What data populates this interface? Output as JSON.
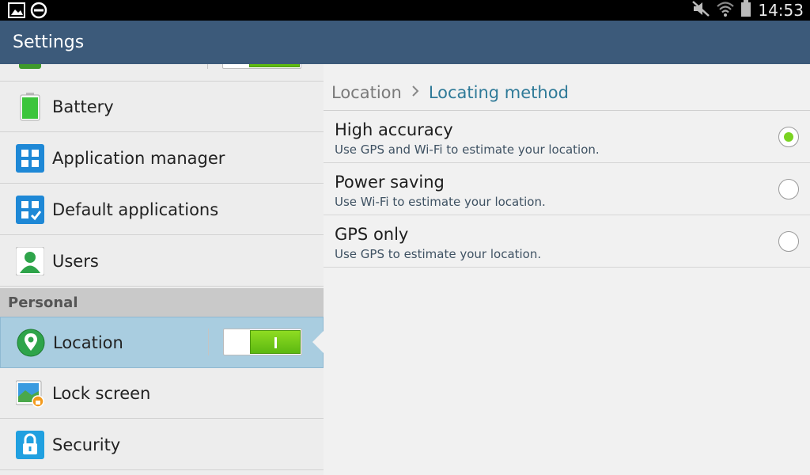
{
  "status_bar": {
    "time": "14:53",
    "left_icons": [
      "gallery-icon",
      "do-not-disturb-icon"
    ],
    "right_icons": [
      "mute-icon",
      "wifi-icon",
      "battery-icon"
    ]
  },
  "action_bar": {
    "title": "Settings"
  },
  "left_pane": {
    "items": [
      {
        "label": "Battery",
        "icon": "battery-icon"
      },
      {
        "label": "Application manager",
        "icon": "application-manager-icon"
      },
      {
        "label": "Default applications",
        "icon": "default-applications-icon"
      },
      {
        "label": "Users",
        "icon": "users-icon"
      }
    ],
    "section_header": "Personal",
    "personal_items": [
      {
        "label": "Location",
        "icon": "location-icon",
        "toggle": "on",
        "selected": true
      },
      {
        "label": "Lock screen",
        "icon": "lock-screen-icon"
      },
      {
        "label": "Security",
        "icon": "security-icon"
      }
    ]
  },
  "right_pane": {
    "breadcrumb": {
      "parent": "Location",
      "current": "Locating method"
    },
    "options": [
      {
        "title": "High accuracy",
        "subtitle": "Use GPS and Wi-Fi to estimate your location.",
        "selected": true
      },
      {
        "title": "Power saving",
        "subtitle": "Use Wi-Fi to estimate your location.",
        "selected": false
      },
      {
        "title": "GPS only",
        "subtitle": "Use GPS to estimate your location.",
        "selected": false
      }
    ]
  },
  "colors": {
    "action_bar": "#3c5a7a",
    "selected_row": "#a9cde0",
    "toggle_on": "#6cc81a",
    "breadcrumb_current": "#2f7a98"
  }
}
